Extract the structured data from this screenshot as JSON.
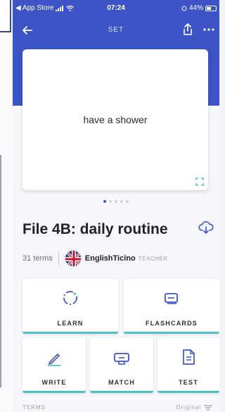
{
  "status_bar": {
    "back_app": "◀ App Store",
    "time": "07:24",
    "battery": "44%"
  },
  "nav": {
    "title": "SET"
  },
  "flashcard": {
    "text": "have a shower",
    "pages": 5,
    "active_page": 1
  },
  "set": {
    "title": "File 4B: daily routine",
    "term_count": "31 terms",
    "creator_name": "EnglishTicino",
    "creator_role": "TEACHER"
  },
  "modes": {
    "learn": "LEARN",
    "flashcards": "FLASHCARDS",
    "write": "WRITE",
    "match": "MATCH",
    "test": "TEST"
  },
  "terms_section": {
    "label": "TERMS",
    "sort": "Original"
  },
  "colors": {
    "header": "#3d54c6",
    "accent": "#4bc3c2",
    "icon": "#3d54c6"
  }
}
